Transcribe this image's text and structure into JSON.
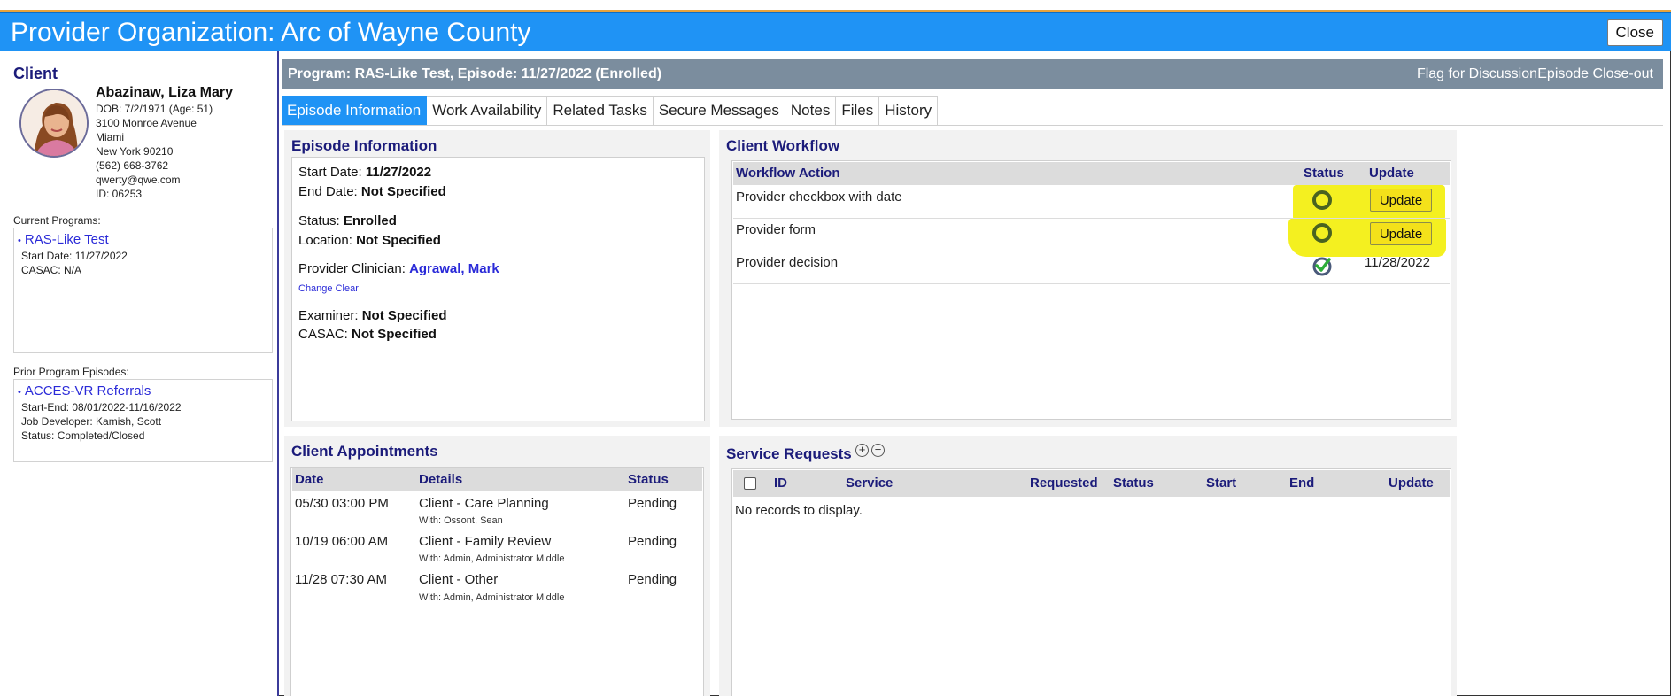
{
  "window": {
    "title": "Provider Organization: Arc of Wayne County",
    "close_label": "Close"
  },
  "sidebar": {
    "heading": "Client",
    "client": {
      "name": "Abazinaw, Liza Mary",
      "dob": "DOB: 7/2/1971 (Age: 51)",
      "address1": "3100 Monroe Avenue",
      "address2": "Miami",
      "address3": "New York 90210",
      "phone": "(562) 668-3762",
      "email": "qwerty@qwe.com",
      "id": "ID: 06253"
    },
    "current_programs_label": "Current Programs:",
    "current_program": {
      "name": "RAS-Like Test",
      "start": "Start Date: 11/27/2022",
      "casac": "CASAC: N/A"
    },
    "prior_label": "Prior Program Episodes:",
    "prior_program": {
      "name": "ACCES-VR Referrals",
      "start_end": "Start-End: 08/01/2022-11/16/2022",
      "job_developer": "Job Developer: Kamish, Scott",
      "status": "Status: Completed/Closed"
    }
  },
  "program_bar": {
    "title": "Program: RAS-Like Test, Episode: 11/27/2022 (Enrolled)",
    "flag_label": "Flag for Discussion",
    "closeout_label": "Episode Close-out"
  },
  "tabs": [
    {
      "label": "Episode Information",
      "active": true
    },
    {
      "label": "Work Availability"
    },
    {
      "label": "Related Tasks"
    },
    {
      "label": "Secure Messages"
    },
    {
      "label": "Notes"
    },
    {
      "label": "Files"
    },
    {
      "label": "History"
    }
  ],
  "episode": {
    "title": "Episode Information",
    "start_label": "Start Date:",
    "start_value": "11/27/2022",
    "end_label": "End Date:",
    "end_value": "Not Specified",
    "status_label": "Status:",
    "status_value": "Enrolled",
    "location_label": "Location:",
    "location_value": "Not Specified",
    "clinician_label": "Provider Clinician:",
    "clinician_value": "Agrawal, Mark",
    "change_clear": "Change Clear",
    "examiner_label": "Examiner:",
    "examiner_value": "Not Specified",
    "casac_label": "CASAC:",
    "casac_value": "Not Specified"
  },
  "workflow": {
    "title": "Client Workflow",
    "headers": {
      "action": "Workflow Action",
      "status": "Status",
      "update": "Update"
    },
    "rows": [
      {
        "action": "Provider checkbox with date",
        "status": "incomplete",
        "update": "Update"
      },
      {
        "action": "Provider form",
        "status": "incomplete",
        "update": "Update"
      },
      {
        "action": "Provider decision",
        "status": "complete",
        "update": "11/28/2022"
      }
    ],
    "colors": {
      "highlight": "#f4f020",
      "button": "#f4e11a",
      "circle": "#4a6320",
      "check": "#2eae3a"
    }
  },
  "appointments": {
    "title": "Client Appointments",
    "headers": {
      "date": "Date",
      "details": "Details",
      "status": "Status"
    },
    "rows": [
      {
        "date": "05/30 03:00 PM",
        "details": "Client - Care Planning",
        "with": "With: Ossont, Sean",
        "status": "Pending"
      },
      {
        "date": "10/19 06:00 AM",
        "details": "Client - Family Review",
        "with": "With: Admin, Administrator Middle",
        "status": "Pending"
      },
      {
        "date": "11/28 07:30 AM",
        "details": "Client - Other",
        "with": "With: Admin, Administrator Middle",
        "status": "Pending"
      }
    ]
  },
  "service_requests": {
    "title": "Service Requests",
    "headers": {
      "id": "ID",
      "service": "Service",
      "requested": "Requested",
      "status": "Status",
      "start": "Start",
      "end": "End",
      "update": "Update"
    },
    "empty": "No records to display.",
    "add_icon": "+",
    "remove_icon": "−"
  }
}
